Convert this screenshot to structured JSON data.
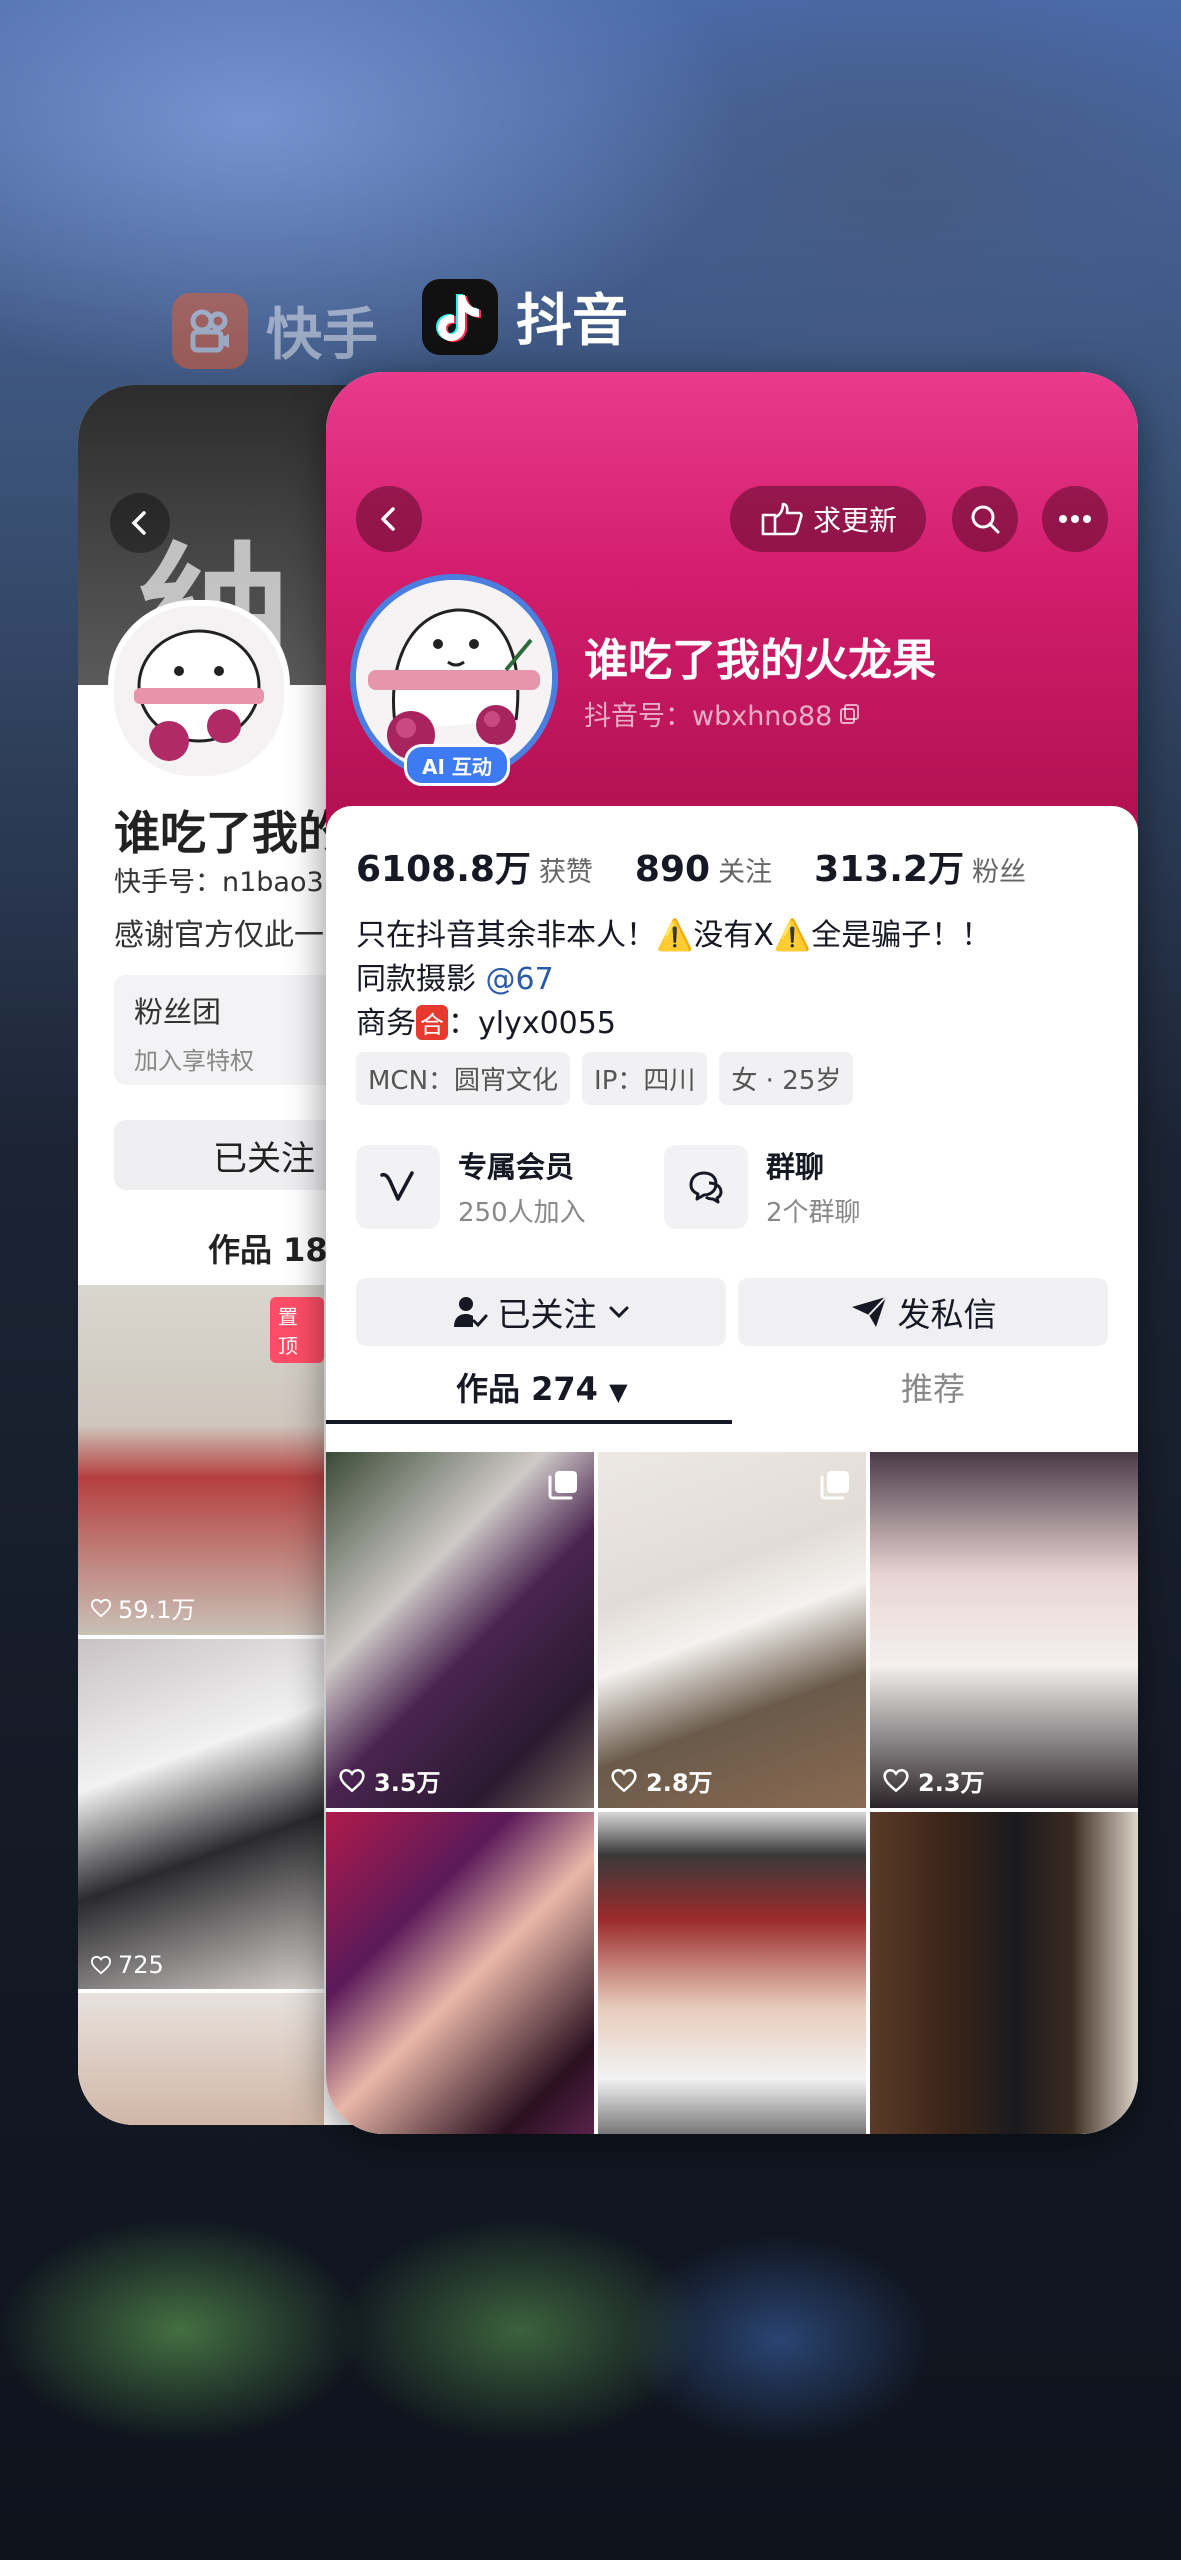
{
  "switcher": {
    "back_app_name": "快手",
    "front_app_name": "抖音"
  },
  "kuaishou": {
    "name": "谁吃了我的",
    "account_id": "快手号：n1bao3",
    "description": "感谢官方仅此一",
    "fan_club_title": "粉丝团",
    "fan_club_sub": "加入享特权",
    "follow_label": "已关注",
    "works_label": "作品 18",
    "pinned_label": "置顶",
    "video_likes": [
      "59.1万",
      "725",
      ""
    ]
  },
  "douyin": {
    "update_button": "求更新",
    "ai_badge": "AI 互动",
    "profile_name": "谁吃了我的火龙果",
    "douyin_id": "抖音号：wbxhno88",
    "stats": {
      "likes_value": "6108.8万",
      "likes_label": "获赞",
      "following_value": "890",
      "following_label": "关注",
      "followers_value": "313.2万",
      "followers_label": "粉丝"
    },
    "bio": {
      "line1": "只在抖音其余非本人！⚠️没有X⚠️全是骗子！！",
      "line2_prefix": "同款摄影 ",
      "line2_link": "@67",
      "line3_prefix": "商务",
      "line3_badge": "合",
      "line3_suffix": "：ylyx0055"
    },
    "tags": [
      "MCN：圆宵文化",
      "IP：四川",
      "女 · 25岁"
    ],
    "features": [
      {
        "title": "专属会员",
        "sub": "250人加入"
      },
      {
        "title": "群聊",
        "sub": "2个群聊"
      }
    ],
    "follow_button": "已关注",
    "message_button": "发私信",
    "tabs": {
      "works": "作品 274",
      "recommended": "推荐"
    },
    "videos": [
      {
        "likes": "3.5万"
      },
      {
        "likes": "2.8万"
      },
      {
        "likes": "2.3万"
      },
      {
        "likes": ""
      },
      {
        "likes": ""
      },
      {
        "likes": ""
      }
    ]
  }
}
